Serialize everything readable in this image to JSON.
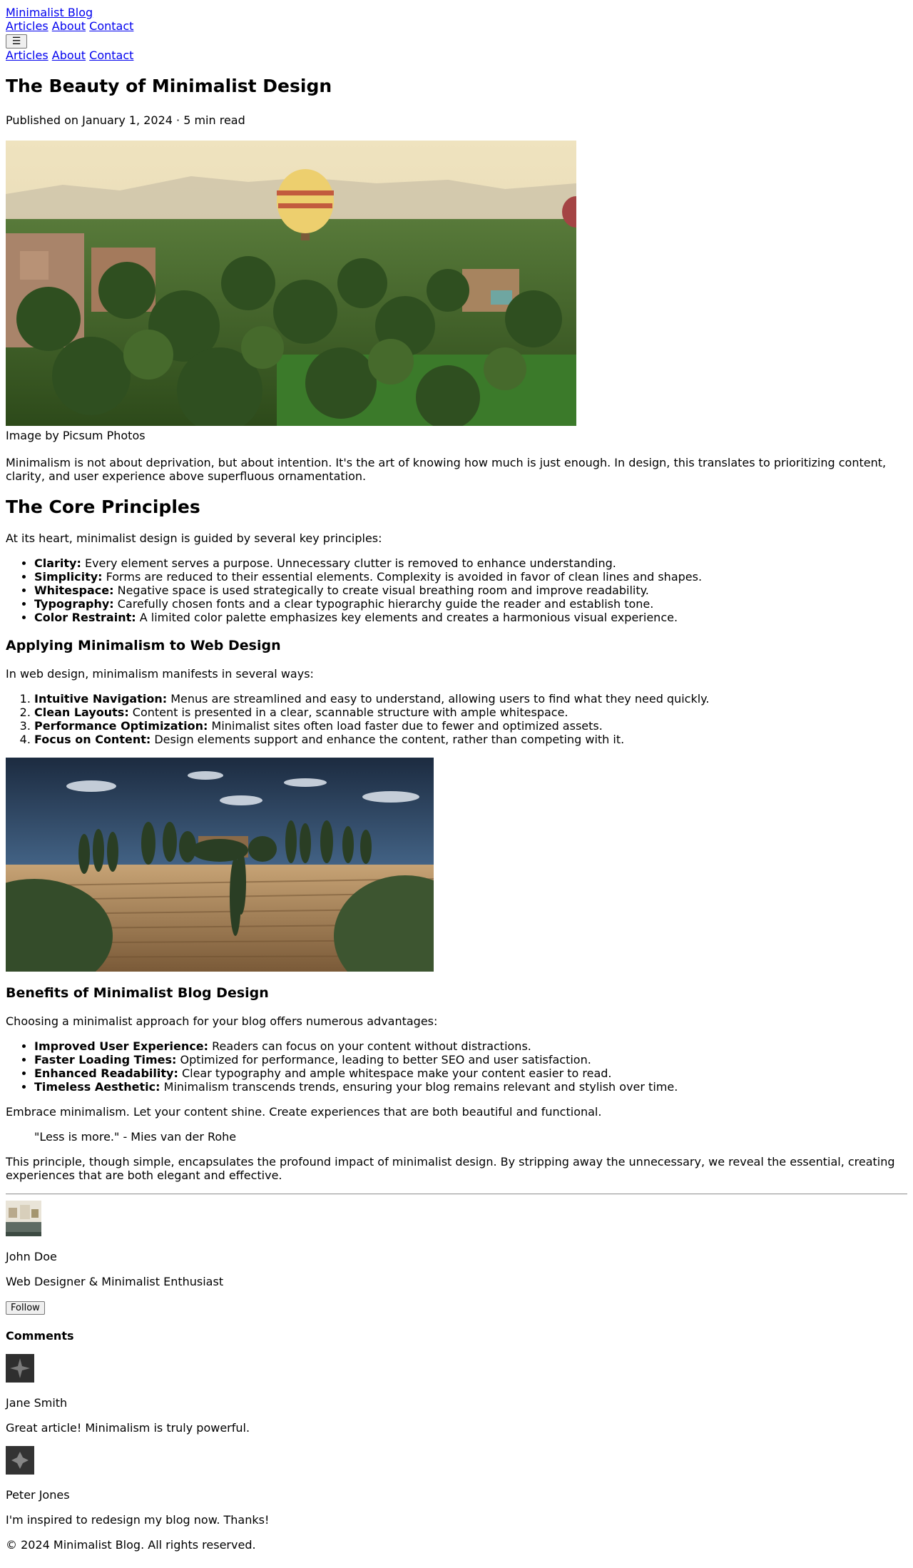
{
  "header": {
    "logo": "Minimalist Blog",
    "nav": [
      "Articles",
      "About",
      "Contact"
    ],
    "menu_icon": "☰",
    "mobile_nav": [
      "Articles",
      "About",
      "Contact"
    ]
  },
  "article": {
    "title": "The Beauty of Minimalist Design",
    "meta": "Published on January 1, 2024 · 5 min read",
    "hero_caption": "Image by Picsum Photos",
    "intro": "Minimalism is not about deprivation, but about intention. It's the art of knowing how much is just enough. In design, this translates to prioritizing content, clarity, and user experience above superfluous ornamentation.",
    "principles": {
      "heading": "The Core Principles",
      "intro": "At its heart, minimalist design is guided by several key principles:",
      "items": [
        {
          "term": "Clarity:",
          "text": " Every element serves a purpose. Unnecessary clutter is removed to enhance understanding."
        },
        {
          "term": "Simplicity:",
          "text": " Forms are reduced to their essential elements. Complexity is avoided in favor of clean lines and shapes."
        },
        {
          "term": "Whitespace:",
          "text": " Negative space is used strategically to create visual breathing room and improve readability."
        },
        {
          "term": "Typography:",
          "text": " Carefully chosen fonts and a clear typographic hierarchy guide the reader and establish tone."
        },
        {
          "term": "Color Restraint:",
          "text": " A limited color palette emphasizes key elements and creates a harmonious visual experience."
        }
      ]
    },
    "web": {
      "heading": "Applying Minimalism to Web Design",
      "intro": "In web design, minimalism manifests in several ways:",
      "items": [
        {
          "term": "Intuitive Navigation:",
          "text": " Menus are streamlined and easy to understand, allowing users to find what they need quickly."
        },
        {
          "term": "Clean Layouts:",
          "text": " Content is presented in a clear, scannable structure with ample whitespace."
        },
        {
          "term": "Performance Optimization:",
          "text": " Minimalist sites often load faster due to fewer and optimized assets."
        },
        {
          "term": "Focus on Content:",
          "text": " Design elements support and enhance the content, rather than competing with it."
        }
      ]
    },
    "benefits": {
      "heading": "Benefits of Minimalist Blog Design",
      "intro": "Choosing a minimalist approach for your blog offers numerous advantages:",
      "items": [
        {
          "term": "Improved User Experience:",
          "text": " Readers can focus on your content without distractions."
        },
        {
          "term": "Faster Loading Times:",
          "text": " Optimized for performance, leading to better SEO and user satisfaction."
        },
        {
          "term": "Enhanced Readability:",
          "text": " Clear typography and ample whitespace make your content easier to read."
        },
        {
          "term": "Timeless Aesthetic:",
          "text": " Minimalism transcends trends, ensuring your blog remains relevant and stylish over time."
        }
      ]
    },
    "embrace": "Embrace minimalism. Let your content shine. Create experiences that are both beautiful and functional.",
    "quote": "\"Less is more.\" - Mies van der Rohe",
    "closing": "This principle, though simple, encapsulates the profound impact of minimalist design. By stripping away the unnecessary, we reveal the essential, creating experiences that are both elegant and effective."
  },
  "author": {
    "name": "John Doe",
    "bio": "Web Designer & Minimalist Enthusiast",
    "follow_label": "Follow"
  },
  "comments": {
    "heading": "Comments",
    "items": [
      {
        "name": "Jane Smith",
        "text": "Great article! Minimalism is truly powerful."
      },
      {
        "name": "Peter Jones",
        "text": "I'm inspired to redesign my blog now. Thanks!"
      }
    ]
  },
  "footer": {
    "copyright": "© 2024 Minimalist Blog. All rights reserved."
  }
}
